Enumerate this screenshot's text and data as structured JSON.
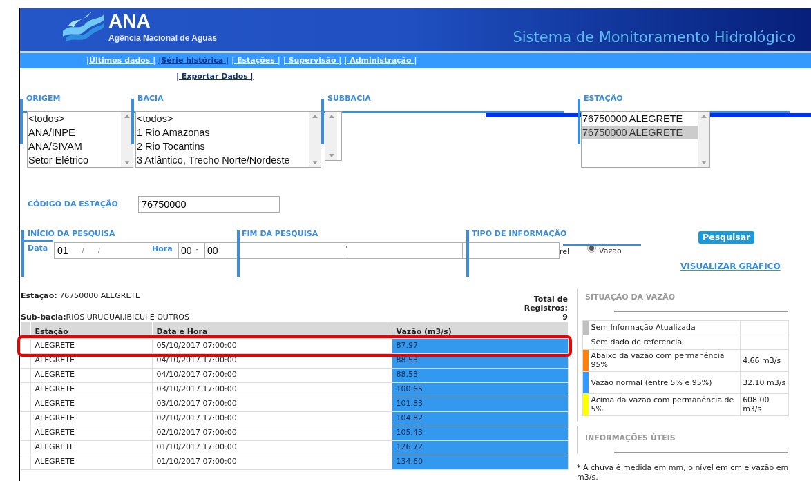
{
  "header": {
    "logo_text": "ANA",
    "subtitle": "Agência Nacional de Aguas",
    "system_title": "Sistema de Monitoramento Hidrológico"
  },
  "nav": [
    {
      "label": "|Últimos dados |",
      "selected": false
    },
    {
      "label": "|Série histórica |",
      "selected": true
    },
    {
      "label": "| Estações |",
      "selected": false
    },
    {
      "label": "| Supervisão |",
      "selected": false
    },
    {
      "label": "| Administração |",
      "selected": false
    }
  ],
  "nav_secondary": [
    "| Exportar Dados |"
  ],
  "filters": [
    {
      "label": "ORIGEM",
      "options": [
        {
          "text": "<todos>",
          "selected": false
        },
        {
          "text": "ANA/INPE",
          "selected": false
        },
        {
          "text": "ANA/SIVAM",
          "selected": false
        },
        {
          "text": "Setor Elétrico",
          "selected": false
        }
      ]
    },
    {
      "label": "BACIA",
      "options": [
        {
          "text": "<todos>",
          "selected": false
        },
        {
          "text": "1 Rio Amazonas",
          "selected": false
        },
        {
          "text": "2 Rio Tocantins",
          "selected": false
        },
        {
          "text": "3 Atlântico, Trecho Norte/Nordeste",
          "selected": false
        }
      ]
    },
    {
      "label": "SUBBACIA"
    },
    {
      "label": "ESTAÇÃO",
      "options": [
        {
          "text": "76750000 ALEGRETE",
          "selected": false
        },
        {
          "text": "76750000 ALEGRETE",
          "selected": true
        }
      ]
    }
  ],
  "station_code": {
    "label": "CÓDIGO DA ESTAÇÃO",
    "value": "76750000"
  },
  "search": {
    "start_label": "INÍCIO DA PESQUISA",
    "end_label": "FIM DA PESQUISA",
    "type_label": "TIPO DE INFORMAÇÃO",
    "date_label": "Data",
    "date_parts": [
      "01",
      "/",
      "/"
    ],
    "hour_label": "Hora",
    "time_parts": [
      "00",
      ":",
      "00"
    ],
    "fragment": "'",
    "type_fragment": "rel",
    "radio": {
      "label": "Vazão",
      "checked": true
    },
    "button": "Pesquisar",
    "chart_link": "VISUALIZAR GRÁFICO"
  },
  "result": {
    "station_label": "Estação:",
    "station_value": "76750000 ALEGRETE",
    "subbasin_label": "Sub-bacia:",
    "subbasin_value": "RIOS URUGUAI,IBICUI E OUTROS",
    "total_label": "Total de Registros:",
    "total_value": "9"
  },
  "table": {
    "columns": [
      "Estação",
      "Data e Hora",
      "Vazão (m3/s)"
    ],
    "rows": [
      {
        "cells": [
          "ALEGRETE",
          "05/10/2017 07:00:00",
          "87.97"
        ],
        "selected": true
      },
      {
        "cells": [
          "ALEGRETE",
          "04/10/2017 17:00:00",
          "88.53"
        ],
        "selected": false
      },
      {
        "cells": [
          "ALEGRETE",
          "04/10/2017 07:00:00",
          "88.53"
        ],
        "selected": false
      },
      {
        "cells": [
          "ALEGRETE",
          "03/10/2017 17:00:00",
          "100.65"
        ],
        "selected": false
      },
      {
        "cells": [
          "ALEGRETE",
          "03/10/2017 07:00:00",
          "101.83"
        ],
        "selected": false
      },
      {
        "cells": [
          "ALEGRETE",
          "02/10/2017 17:00:00",
          "104.82"
        ],
        "selected": false
      },
      {
        "cells": [
          "ALEGRETE",
          "02/10/2017 07:00:00",
          "105.43"
        ],
        "selected": false
      },
      {
        "cells": [
          "ALEGRETE",
          "01/10/2017 17:00:00",
          "126.72"
        ],
        "selected": false
      },
      {
        "cells": [
          "ALEGRETE",
          "01/10/2017 07:00:00",
          "134.60"
        ],
        "selected": false
      }
    ]
  },
  "legend": {
    "title": "SITUAÇÃO DA VAZÃO",
    "items": [
      {
        "label": "Sem Informação Atualizada",
        "color": "#c0c0c0"
      },
      {
        "label": "Sem dado de referencia",
        "color": "#ffffff"
      },
      {
        "label": "Abaixo da vazão com permanência 95%",
        "value": "4.66 m3/s",
        "color": "#ff7f0e"
      },
      {
        "label": "Vazão normal (entre 5% e 95%)",
        "value": "32.10 m3/s",
        "color": "#3399ff"
      },
      {
        "label": "Acima da vazão com permanência de 5%",
        "value": "608.00 m3/s",
        "color": "#ffff00"
      }
    ]
  },
  "info": {
    "title": "INFORMAÇÕES ÚTEIS",
    "text": "* A chuva é medida em mm, o nível em cm e vazão em m3/s."
  }
}
